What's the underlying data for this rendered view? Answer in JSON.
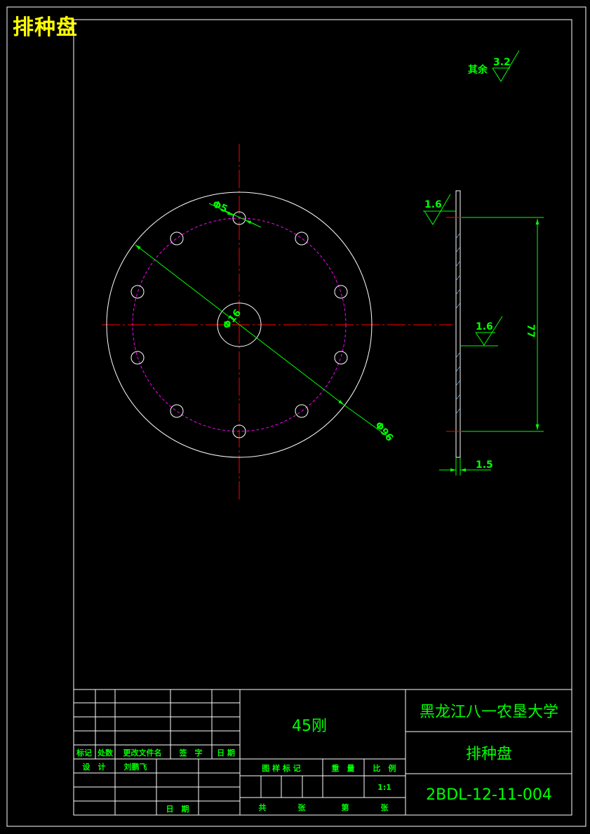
{
  "overlay_title": "排种盘",
  "roughness": {
    "general_label": "其余",
    "general_value": "3.2",
    "face_top_value": "1.6",
    "face_mid_value": "1.6"
  },
  "dimensions": {
    "hole_diameter": "Φ5",
    "center_hole": "Φ16",
    "outer_diameter": "Φ96",
    "height": "77",
    "thickness": "1.5"
  },
  "title_block": {
    "material": "45刚",
    "university": "黑龙江八一农垦大学",
    "part_name": "排种盘",
    "drawing_number": "2BDL-12-11-004",
    "scale": "1:1",
    "headers": {
      "mark": "标记",
      "count": "处数",
      "change_doc": "更改文件名",
      "sign": "签　字",
      "date": "日 期",
      "design": "设　计",
      "designer": "刘鹏飞",
      "date2": "日　期",
      "stage_mark": "图 样 标 记",
      "weight": "重　量",
      "ratio": "比　例",
      "total": "共",
      "sheets": "张",
      "page": "第",
      "sheet2": "张"
    }
  }
}
